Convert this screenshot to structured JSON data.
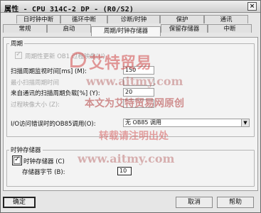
{
  "window": {
    "title": "属性 - CPU 314C-2 DP - (R0/S2)",
    "close_label": "×"
  },
  "tabs": {
    "row1": [
      "日时钟中断",
      "循环中断",
      "诊断/时钟",
      "保护",
      "通讯"
    ],
    "row2": [
      "常规",
      "启动",
      "周期/时钟存储器",
      "保留存储器",
      "中断"
    ],
    "active": "周期/时钟存储器"
  },
  "cycle_group": {
    "label": "周期",
    "update_oob_label": "周期性更新 OB1 过程映像(U)",
    "update_oob_checked": true,
    "scan_monitor_label": "扫描周期监视时间[ms] (M):",
    "scan_monitor_value": "150",
    "min_scan_label": "最小扫描周期时间",
    "comm_load_label": "来自通讯的扫描周期负载[%] (Y):",
    "comm_load_value": "20",
    "process_image_label": "过程映像大小 (Z):",
    "io_error_label": "I/O访问错误时的OB85调用(O):",
    "io_error_value": "无 OB85 调用"
  },
  "clock_group": {
    "label": "时钟存储器",
    "clock_mem_label": "时钟存储器 (C)",
    "clock_mem_checked": true,
    "mem_byte_label": "存储器字节 (B):",
    "mem_byte_value": "10"
  },
  "buttons": {
    "ok": "确定",
    "cancel": "取消",
    "help": "帮助"
  },
  "watermark": {
    "brand": "艾特贸易",
    "url1": "www.aitmy.com",
    "notice": "本文为艾特贸易网原创",
    "forbid": "转载请注明出处",
    "url2": "www.aitmy.com"
  },
  "icons": {
    "check": "✓",
    "dropdown": "▼"
  }
}
